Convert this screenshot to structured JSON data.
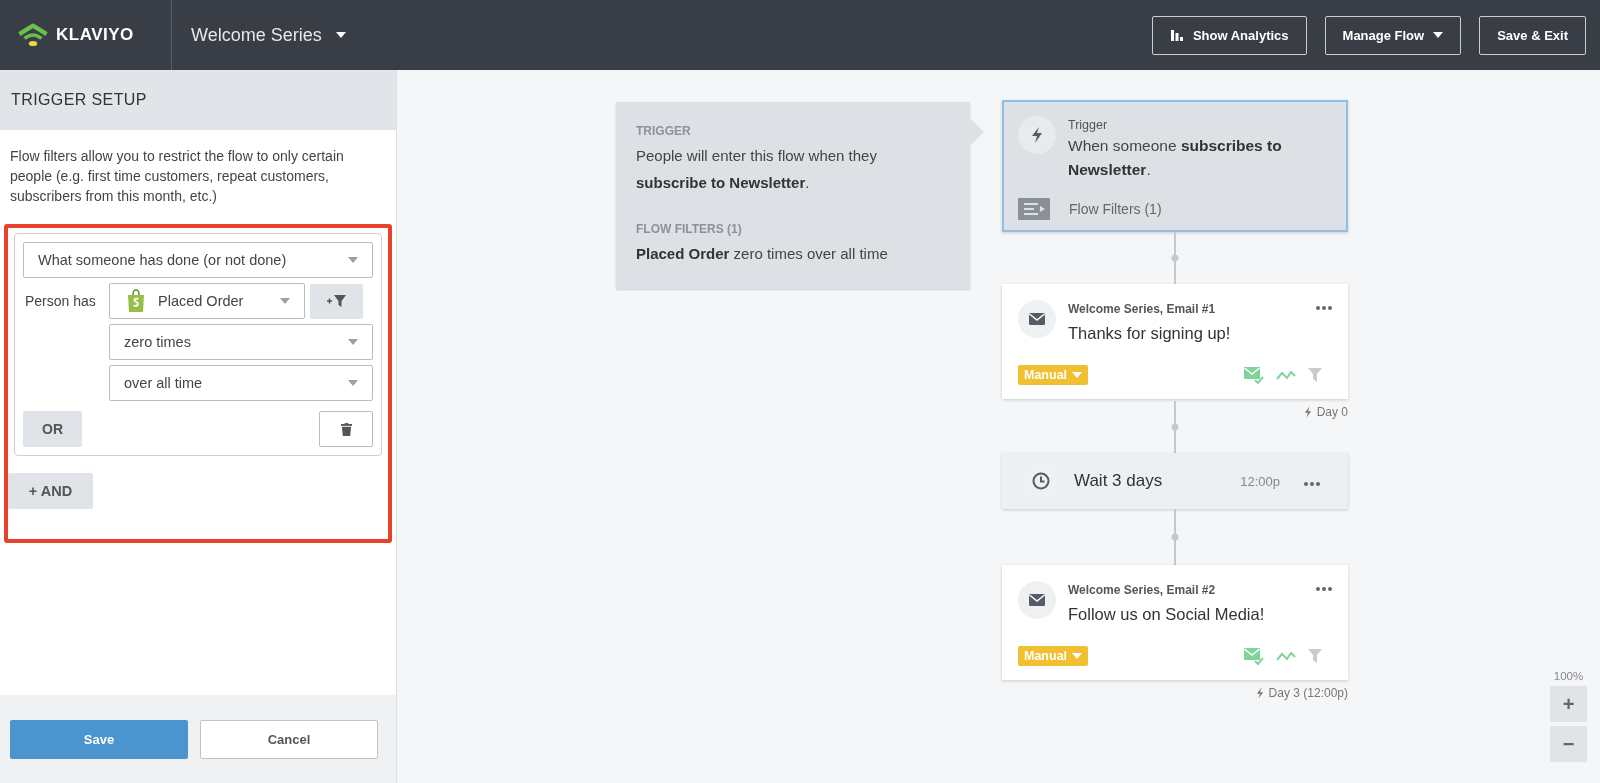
{
  "header": {
    "logo": "KLAVIYO",
    "flow_name": "Welcome Series",
    "buttons": [
      {
        "kind": "analytics",
        "label": "Show Analytics"
      },
      {
        "kind": "menu",
        "label": "Manage Flow"
      },
      {
        "kind": "plain",
        "label": "Save & Exit"
      }
    ]
  },
  "sidebar": {
    "title": "TRIGGER SETUP",
    "intro": "Flow filters allow you to restrict the flow to only certain people (e.g. first time customers, repeat customers, subscribers from this month, etc.)",
    "filter_group": {
      "highlighted": true,
      "condition_type": "What someone has done (or not done)",
      "row_label": "Person has",
      "metric": "Placed Order",
      "frequency": "zero times",
      "timeframe": "over all time",
      "or_button": "OR",
      "and_button": "+ AND"
    },
    "save_button": "Save",
    "cancel_button": "Cancel"
  },
  "summary": {
    "trigger_heading": "TRIGGER",
    "trigger_text": "People will enter this flow when they **subscribe to Newsletter**.",
    "filters_heading": "FLOW FILTERS (1)",
    "filters_text": "**Placed Order** zero times over all time"
  },
  "flow": [
    {
      "kind": "trigger",
      "selected": true,
      "label": "Trigger",
      "text": "When someone **subscribes to Newsletter**.",
      "filters": "Flow Filters (1)"
    },
    {
      "kind": "email",
      "selected": false,
      "label": "Welcome Series, Email #1",
      "text": "Thanks for signing up!",
      "mode": "Manual",
      "statuses": [
        {
          "kind": "mail-check",
          "on": true
        },
        {
          "kind": "trend",
          "on": true
        },
        {
          "kind": "filter",
          "on": false
        }
      ],
      "day": "Day 0"
    },
    {
      "kind": "wait",
      "selected": false,
      "text": "Wait 3 days",
      "time": "12:00p"
    },
    {
      "kind": "email",
      "selected": false,
      "label": "Welcome Series, Email #2",
      "text": "Follow us on Social Media!",
      "mode": "Manual",
      "statuses": [
        {
          "kind": "mail-check",
          "on": true
        },
        {
          "kind": "trend",
          "on": true
        },
        {
          "kind": "filter",
          "on": false
        }
      ],
      "day": "Day 3 (12:00p)"
    }
  ],
  "zoom": {
    "level_text": "100%",
    "zoom_in": "+",
    "zoom_out": "−"
  }
}
